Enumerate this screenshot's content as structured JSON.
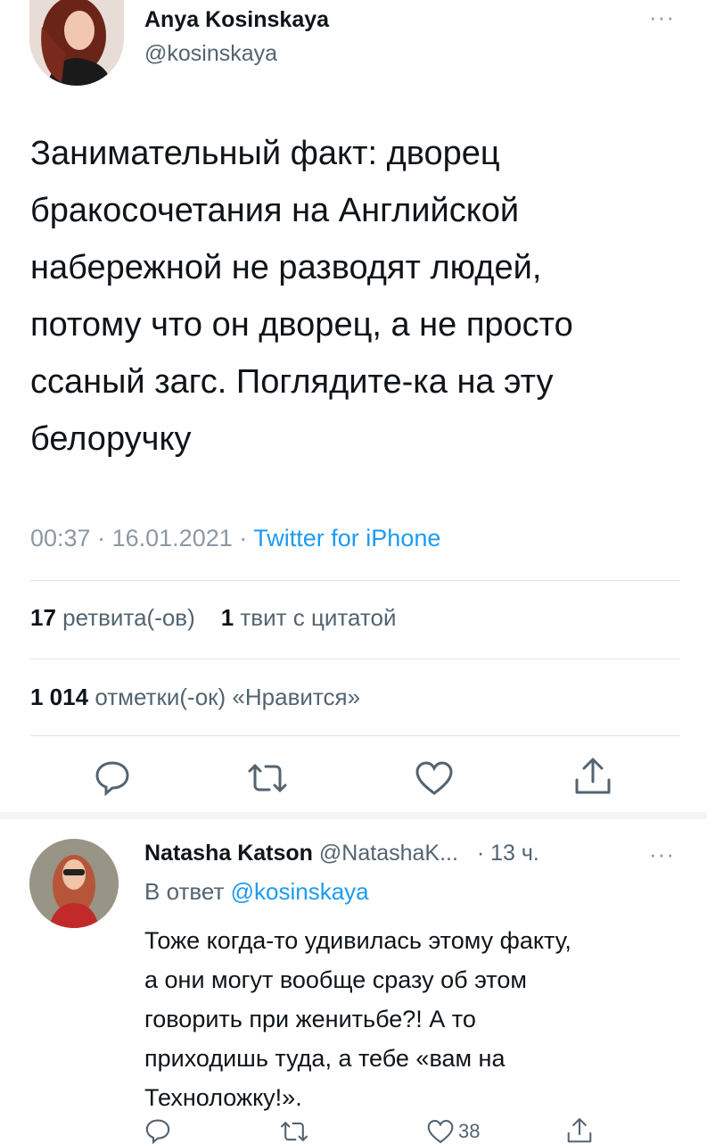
{
  "main_tweet": {
    "author_name": "Anya Kosinskaya",
    "author_handle": "@kosinskaya",
    "more": "···",
    "text_lines": [
      "Занимательный факт: дворец",
      "бракосочетания на Английской",
      "набережной не разводят людей,",
      "потому что он дворец, а не просто",
      "ссаный загс. Поглядите-ка на эту",
      "белоручку"
    ],
    "time": "00:37",
    "date": "16.01.2021",
    "dot": "·",
    "source": "Twitter for iPhone",
    "stats": {
      "retweets_count": "17",
      "retweets_label": "ретвита(-ов)",
      "quotes_count": "1",
      "quotes_label": "твит с цитатой",
      "likes_count": "1 014",
      "likes_label": "отметки(-ок) «Нравится»"
    }
  },
  "reply": {
    "author_name": "Natasha Katson",
    "author_handle": "@NatashaK...",
    "time": "· 13 ч.",
    "more": "···",
    "reply_to_label": "В ответ",
    "reply_to_handle": "@kosinskaya",
    "text_lines": [
      "Тоже когда-то удивилась этому факту,",
      "а они могут вообще сразу об этом",
      "говорить при женитьбе?! А то",
      "приходишь туда, а тебе «вам на",
      "Техноложку!»."
    ],
    "like_count": "38"
  },
  "icons": {
    "reply": "reply-icon",
    "retweet": "retweet-icon",
    "like": "heart-icon",
    "share": "share-icon"
  },
  "colors": {
    "accent": "#1d9bf0",
    "secondary_text": "#536471"
  }
}
